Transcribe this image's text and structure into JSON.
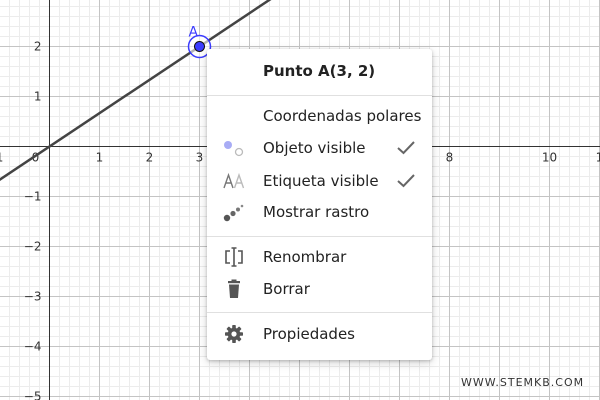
{
  "point": {
    "label": "A",
    "x": 3,
    "y": 2,
    "color": "#3c3cff"
  },
  "line": {
    "slope": 0.6667,
    "intercept": 0,
    "color": "#444444"
  },
  "axes": {
    "x_ticks": [
      {
        "value": -1,
        "label": "1"
      },
      {
        "value": 0,
        "label": "0"
      },
      {
        "value": 1,
        "label": "1"
      },
      {
        "value": 2,
        "label": "2"
      },
      {
        "value": 3,
        "label": "3"
      },
      {
        "value": 8,
        "label": "8"
      },
      {
        "value": 10,
        "label": "10"
      },
      {
        "value": 11,
        "label": "1"
      }
    ],
    "y_ticks": [
      {
        "value": 2,
        "label": "2"
      },
      {
        "value": 1,
        "label": "1"
      },
      {
        "value": -1,
        "label": "−1"
      },
      {
        "value": -2,
        "label": "−2"
      },
      {
        "value": -3,
        "label": "−3"
      },
      {
        "value": -4,
        "label": "−4"
      },
      {
        "value": -5,
        "label": "−5"
      }
    ]
  },
  "menu": {
    "title": "Punto A(3, 2)",
    "items": [
      {
        "label": "Coordenadas polares",
        "icon": "none",
        "checked": false
      },
      {
        "label": "Objeto visible",
        "icon": "visibility-icon",
        "checked": true
      },
      {
        "label": "Etiqueta visible",
        "icon": "label-aa-icon",
        "checked": true
      },
      {
        "label": "Mostrar rastro",
        "icon": "trace-icon",
        "checked": false
      },
      {
        "label": "Renombrar",
        "icon": "rename-icon",
        "checked": false
      },
      {
        "label": "Borrar",
        "icon": "trash-icon",
        "checked": false
      },
      {
        "label": "Propiedades",
        "icon": "gear-icon",
        "checked": false
      }
    ]
  },
  "watermark": "WWW.STEMKB.COM"
}
